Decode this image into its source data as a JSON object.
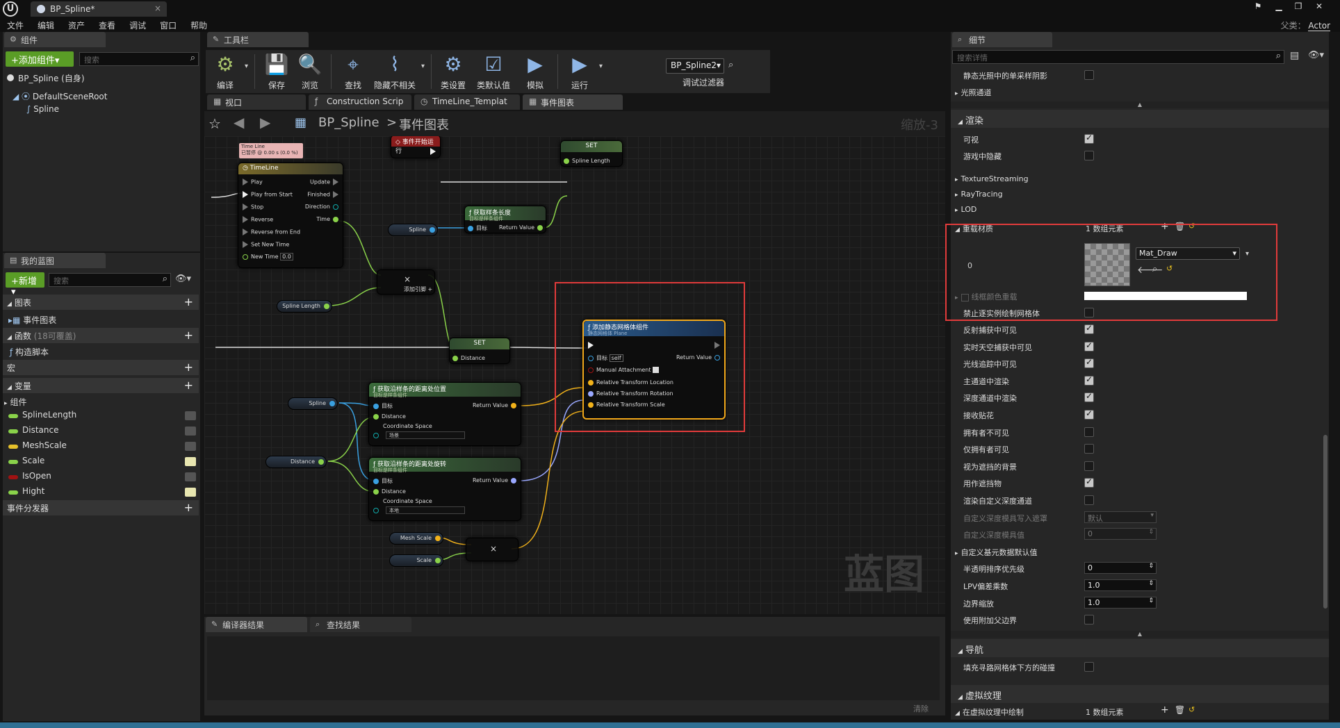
{
  "window": {
    "tab_title": "BP_Spline*",
    "parent_label": "父类：",
    "parent_value": "Actor"
  },
  "menu": [
    "文件",
    "编辑",
    "资产",
    "查看",
    "调试",
    "窗口",
    "帮助"
  ],
  "components": {
    "tab": "组件",
    "add_button": "+添加组件▾",
    "search_placeholder": "搜索",
    "self_item": "BP_Spline (自身)",
    "root": "DefaultSceneRoot",
    "child": "Spline"
  },
  "myblueprint": {
    "tab": "我的蓝图",
    "new_button": "+新增▾",
    "search_placeholder": "搜索",
    "graphs": "图表",
    "event_graph": "事件图表",
    "functions": "函数",
    "functions_count": "(18可覆盖)",
    "construction": "构造脚本",
    "macros": "宏",
    "variables": "变量",
    "components_group": "组件",
    "vars": [
      {
        "name": "SplineLength",
        "color": "#8ad24a",
        "eye": false
      },
      {
        "name": "Distance",
        "color": "#8ad24a",
        "eye": false
      },
      {
        "name": "MeshScale",
        "color": "#e6c12b",
        "eye": false
      },
      {
        "name": "Scale",
        "color": "#8ad24a",
        "eye": true
      },
      {
        "name": "IsOpen",
        "color": "#a01212",
        "eye": false
      },
      {
        "name": "Hight",
        "color": "#8ad24a",
        "eye": true
      }
    ],
    "dispatchers": "事件分发器"
  },
  "toolbar": {
    "tab": "工具栏",
    "compile": "编译",
    "save": "保存",
    "browse": "浏览",
    "find": "查找",
    "hide_unrelated": "隐藏不相关",
    "class_settings": "类设置",
    "class_defaults": "类默认值",
    "simulate": "模拟",
    "play": "运行",
    "debug_object": "BP_Spline2▾",
    "debug_filter": "调试过滤器"
  },
  "graph_tabs": [
    "视口",
    "Construction Scrip",
    "TimeLine_Templat",
    "事件图表"
  ],
  "graph": {
    "breadcrumb_root": "BP_Spline",
    "breadcrumb_sep": ">",
    "breadcrumb_leaf": "事件图表",
    "zoom": "缩放-3",
    "watermark": "蓝图",
    "timeline_comment_1": "Time Line",
    "timeline_comment_2": "已暂停 @ 0.00 s (0.0 %)",
    "timeline": {
      "title": "TimeLine",
      "inputs": [
        "Play",
        "Play from Start",
        "Stop",
        "Reverse",
        "Reverse from End",
        "Set New Time"
      ],
      "new_time_label": "New Time",
      "new_time_value": "0.0",
      "outputs": [
        "Update",
        "Finished",
        "Direction",
        "Time"
      ]
    },
    "event_begin": "事件开始运行",
    "set1": {
      "title": "SET",
      "pin": "Spline Length"
    },
    "get_length": {
      "title": "获取样条长度",
      "sub": "目标是样条组件",
      "target": "目标",
      "ret": "Return Value"
    },
    "var_spline": "Spline",
    "var_spline_length": "Spline Length",
    "add_pin": {
      "symbol": "×",
      "label": "添加引脚 +"
    },
    "set2": {
      "title": "SET",
      "pin": "Distance"
    },
    "get_loc": {
      "title": "获取沿样条的距离处位置",
      "sub": "目标是样条组件",
      "target": "目标",
      "ret": "Return Value",
      "dist": "Distance",
      "space": "Coordinate Space",
      "space_val": "场景"
    },
    "get_rot": {
      "title": "获取沿样条的距离处旋转",
      "sub": "目标是样条组件",
      "target": "目标",
      "ret": "Return Value",
      "dist": "Distance",
      "space": "Coordinate Space",
      "space_val": "本地"
    },
    "var_distance": "Distance",
    "var_mesh_scale": "Mesh Scale",
    "var_scale": "Scale",
    "mult_symbol": "×",
    "add_mesh": {
      "title": "添加静态网格体组件",
      "sub": "静态网格体 Plane",
      "target": "目标",
      "self": "self",
      "ret": "Return Value",
      "manual": "Manual Attachment",
      "loc": "Relative Transform Location",
      "rot": "Relative Transform Rotation",
      "scale": "Relative Transform Scale"
    }
  },
  "bottom": {
    "tab1": "编译器结果",
    "tab2": "查找结果",
    "clear": "清除"
  },
  "details": {
    "tab": "细节",
    "search_placeholder": "搜索详情",
    "row_static_shadow": "静态光照中的单采样阴影",
    "lighting_channels": "光照通道",
    "render_section": "渲染",
    "visible": "可视",
    "hidden_in_game": "游戏中隐藏",
    "texture_streaming": "TextureStreaming",
    "raytracing": "RayTracing",
    "lod": "LOD",
    "override_materials": "重载材质",
    "array_count": "1 数组元素",
    "index0": "0",
    "material_name": "Mat_Draw",
    "wireframe_override": "线框颜色重载",
    "disable_instance_lod": "禁止逐实例绘制网格体",
    "rows": [
      {
        "label": "反射捕获中可见",
        "type": "check",
        "on": true
      },
      {
        "label": "实时天空捕获中可见",
        "type": "check",
        "on": true
      },
      {
        "label": "光线追踪中可见",
        "type": "check",
        "on": true
      },
      {
        "label": "主通道中渲染",
        "type": "check",
        "on": true
      },
      {
        "label": "深度通道中渲染",
        "type": "check",
        "on": true
      },
      {
        "label": "接收贴花",
        "type": "check",
        "on": true
      },
      {
        "label": "拥有者不可见",
        "type": "check",
        "on": false
      },
      {
        "label": "仅拥有者可见",
        "type": "check",
        "on": false
      },
      {
        "label": "视为遮挡的背景",
        "type": "check",
        "on": false
      },
      {
        "label": "用作遮挡物",
        "type": "check",
        "on": true
      },
      {
        "label": "渲染自定义深度通道",
        "type": "check",
        "on": false
      },
      {
        "label": "自定义深度模具写入遮罩",
        "type": "select",
        "value": "默认",
        "dim": true
      },
      {
        "label": "自定义深度模具值",
        "type": "num",
        "value": "0",
        "dim": true
      },
      {
        "label": "自定义基元数据默认值",
        "type": "group"
      },
      {
        "label": "半透明排序优先级",
        "type": "num",
        "value": "0"
      },
      {
        "label": "LPV偏差乘数",
        "type": "num",
        "value": "1.0"
      },
      {
        "label": "边界缩放",
        "type": "num",
        "value": "1.0"
      },
      {
        "label": "使用附加父边界",
        "type": "check",
        "on": false
      }
    ],
    "nav_section": "导航",
    "nav_row": "填充寻路网格体下方的碰撞",
    "vt_section": "虚拟纹理",
    "vt_row": "在虚拟纹理中绘制",
    "vt_count": "1 数组元素"
  }
}
